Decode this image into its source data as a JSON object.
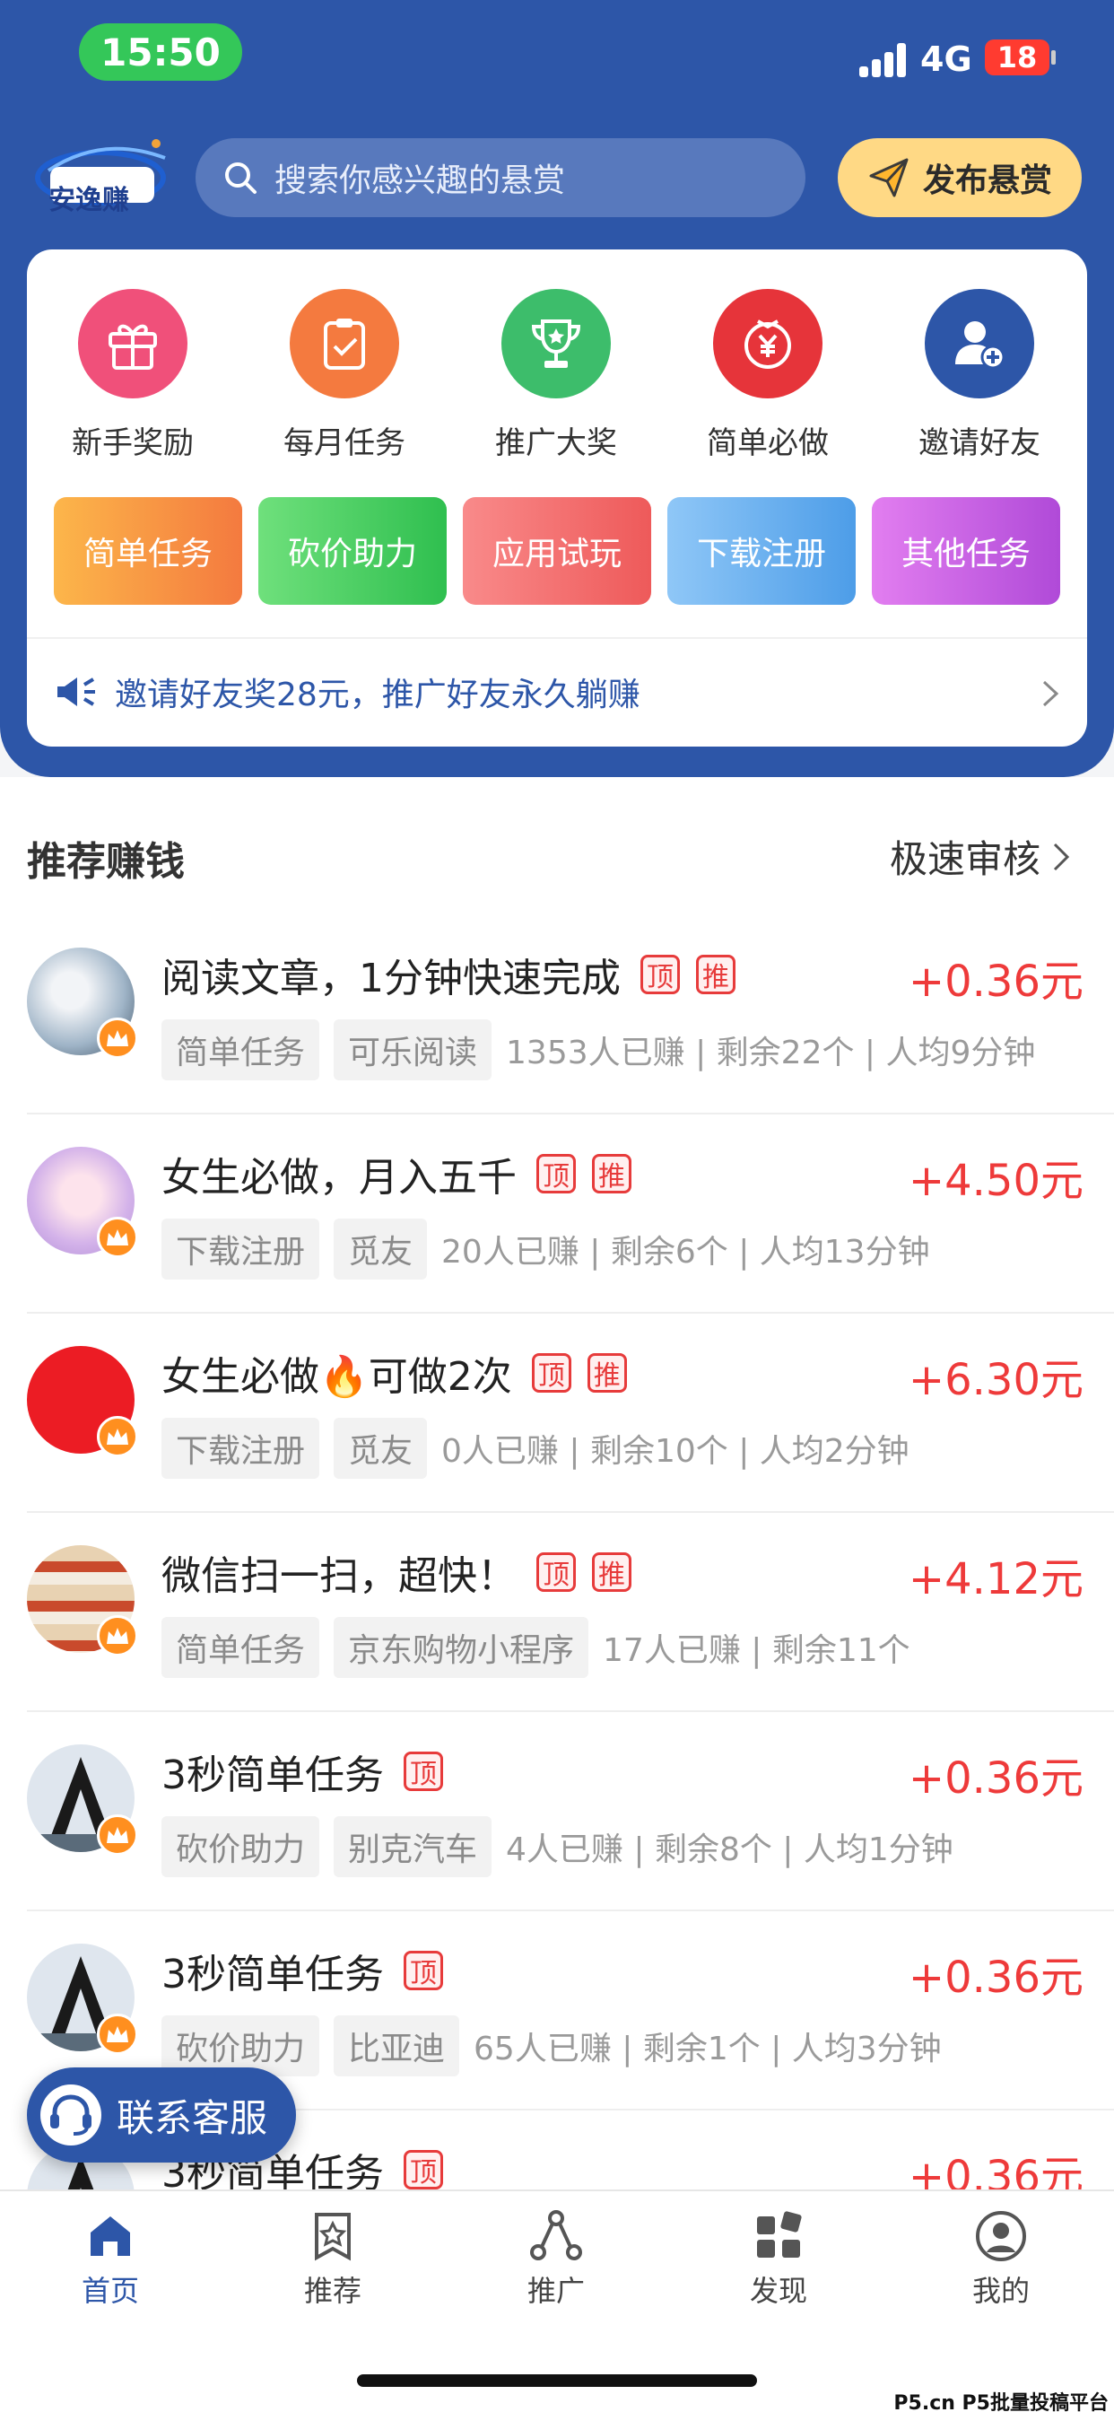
{
  "status": {
    "time": "15:50",
    "network": "4G",
    "battery": "18"
  },
  "header": {
    "logo_text": "安逸赚",
    "search_placeholder": "搜索你感兴趣的悬赏",
    "publish_label": "发布悬赏"
  },
  "features": [
    {
      "label": "新手奖励",
      "icon": "gift-icon",
      "color": "#f0507a"
    },
    {
      "label": "每月任务",
      "icon": "clipboard-check-icon",
      "color": "#f47a3f"
    },
    {
      "label": "推广大奖",
      "icon": "trophy-icon",
      "color": "#3dbd6b"
    },
    {
      "label": "简单必做",
      "icon": "yen-icon",
      "color": "#e6343a"
    },
    {
      "label": "邀请好友",
      "icon": "add-user-icon",
      "color": "#2d56a8"
    }
  ],
  "categories": [
    {
      "label": "简单任务",
      "from": "#fcb64a",
      "to": "#f47a3f"
    },
    {
      "label": "砍价助力",
      "from": "#6fe07c",
      "to": "#2fbf4f"
    },
    {
      "label": "应用试玩",
      "from": "#f98a8a",
      "to": "#ee5a5a"
    },
    {
      "label": "下载注册",
      "from": "#8fc7f7",
      "to": "#4d9de8"
    },
    {
      "label": "其他任务",
      "from": "#e27ef0",
      "to": "#b04ad8"
    }
  ],
  "notice": {
    "text": "邀请好友奖28元，推广好友永久躺赚"
  },
  "section": {
    "title": "推荐赚钱",
    "more": "极速审核"
  },
  "tasks": [
    {
      "title": "阅读文章，1分钟快速完成",
      "badges": [
        "顶",
        "推"
      ],
      "reward": "+0.36元",
      "tags": [
        "简单任务",
        "可乐阅读"
      ],
      "stats": "1353人已赚 | 剩余22个 | 人均9分钟",
      "avatar": "moon-avatar"
    },
    {
      "title": "女生必做，月入五千",
      "badges": [
        "顶",
        "推"
      ],
      "reward": "+4.50元",
      "tags": [
        "下载注册",
        "觅友"
      ],
      "stats": "20人已赚 | 剩余6个 | 人均13分钟",
      "avatar": "anime-girl-avatar"
    },
    {
      "title": "女生必做🔥可做2次",
      "badges": [
        "顶",
        "推"
      ],
      "reward": "+6.30元",
      "tags": [
        "下载注册",
        "觅友"
      ],
      "stats": "0人已赚 | 剩余10个 | 人均2分钟",
      "avatar": "red-avatar"
    },
    {
      "title": "微信扫一扫，超快！",
      "badges": [
        "顶",
        "推"
      ],
      "reward": "+4.12元",
      "tags": [
        "简单任务",
        "京东购物小程序"
      ],
      "stats": "17人已赚 | 剩余11个",
      "avatar": "shop-avatar"
    },
    {
      "title": "3秒简单任务",
      "badges": [
        "顶"
      ],
      "reward": "+0.36元",
      "tags": [
        "砍价助力",
        "别克汽车"
      ],
      "stats": "4人已赚 | 剩余8个 | 人均1分钟",
      "avatar": "arch-avatar"
    },
    {
      "title": "3秒简单任务",
      "badges": [
        "顶"
      ],
      "reward": "+0.36元",
      "tags": [
        "砍价助力",
        "比亚迪"
      ],
      "stats": "65人已赚 | 剩余1个 | 人均3分钟",
      "avatar": "arch-avatar"
    },
    {
      "title": "3秒简单任务",
      "badges": [
        "顶"
      ],
      "reward": "+0.36元",
      "tags": [],
      "stats": "",
      "avatar": "arch-avatar"
    }
  ],
  "customer_service": {
    "label": "联系客服"
  },
  "tabbar": [
    {
      "label": "首页",
      "icon": "home-icon",
      "active": true
    },
    {
      "label": "推荐",
      "icon": "star-tag-icon",
      "active": false
    },
    {
      "label": "推广",
      "icon": "share-icon",
      "active": false
    },
    {
      "label": "发现",
      "icon": "grid-icon",
      "active": false
    },
    {
      "label": "我的",
      "icon": "profile-icon",
      "active": false
    }
  ],
  "watermark": "P5.cn P5批量投稿平台"
}
